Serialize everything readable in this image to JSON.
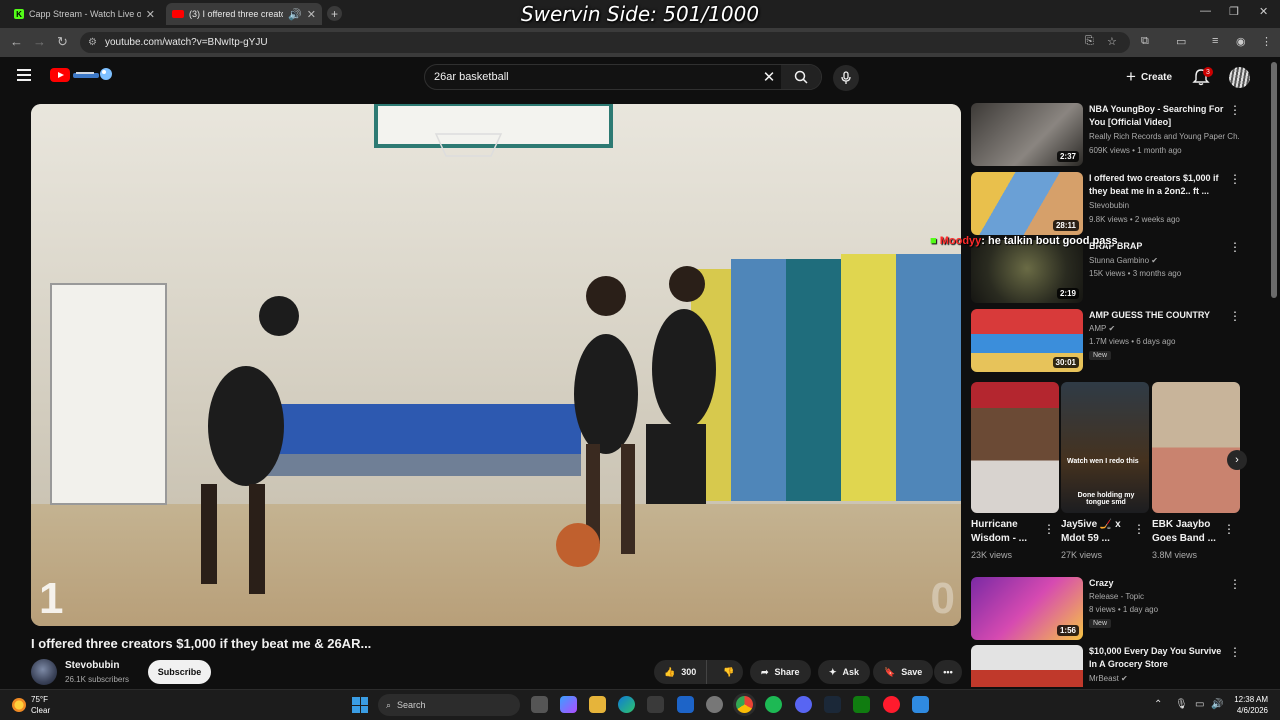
{
  "browser": {
    "tabs": [
      {
        "title": "Capp Stream - Watch Live on K",
        "favicon": "kick-icon",
        "color": "#53fc18"
      },
      {
        "title": "(3) I offered three creators $",
        "favicon": "youtube-icon",
        "color": "#ff0000",
        "active": true
      }
    ],
    "overlay_title": "Swervin Side: 501/1000",
    "url": "youtube.com/watch?v=BNwItp-gYJU"
  },
  "youtube": {
    "search": {
      "value": "26ar basketball",
      "placeholder": "Search"
    },
    "create_label": "Create",
    "notifications_count": "3"
  },
  "video": {
    "title": "I offered three creators $1,000 if they beat me & 26AR...",
    "score_left": "1",
    "score_right": "0",
    "channel": {
      "name": "Stevobubin",
      "subscribers": "26.1K subscribers"
    },
    "subscribe_label": "Subscribe",
    "likes": "300",
    "share_label": "Share",
    "ask_label": "Ask",
    "save_label": "Save"
  },
  "sidebar": {
    "videos": [
      {
        "title": "NBA YoungBoy - Searching For You [Official Video]",
        "channel": "Really Rich Records and Young Paper Ch...",
        "meta": "609K views • 1 month ago",
        "duration": "2:37"
      },
      {
        "title": "I offered two creators $1,000 if they beat me in a 2on2.. ft ...",
        "channel": "Stevobubin",
        "meta": "9.8K views • 2 weeks ago",
        "duration": "28:11"
      },
      {
        "title": "BRAP BRAP",
        "channel": "Stunna Gambino",
        "meta": "15K views • 3 months ago",
        "duration": "2:19",
        "verified": true
      },
      {
        "title": "AMP GUESS THE COUNTRY",
        "channel": "AMP",
        "meta": "1.7M views • 6 days ago",
        "duration": "30:01",
        "verified": true,
        "badge": "New"
      }
    ],
    "shorts": [
      {
        "title": "Hurricane Wisdom - ...",
        "views": "23K views",
        "overlay": ""
      },
      {
        "title": "Jay5ive 🏒 x Mdot 59 ...",
        "views": "27K views",
        "overlay": "Watch wen I redo this",
        "overlay2": "Done holding my tongue smd"
      },
      {
        "title": "EBK Jaaybo Goes Band ...",
        "views": "3.8M views",
        "overlay": ""
      }
    ],
    "videos2": [
      {
        "title": "Crazy",
        "channel": "Release - Topic",
        "meta": "8 views • 1 day ago",
        "duration": "1:56",
        "badge": "New"
      },
      {
        "title": "$10,000 Every Day You Survive In A Grocery Store",
        "channel": "MrBeast",
        "meta": "",
        "duration": "",
        "verified": true
      }
    ],
    "chat_overlay": {
      "name": "Moodyy",
      "message": "he talkin bout good pass"
    }
  },
  "taskbar": {
    "weather": {
      "temp": "75°F",
      "condition": "Clear"
    },
    "search_label": "Search",
    "time": "12:38 AM",
    "date": "4/6/2026"
  }
}
